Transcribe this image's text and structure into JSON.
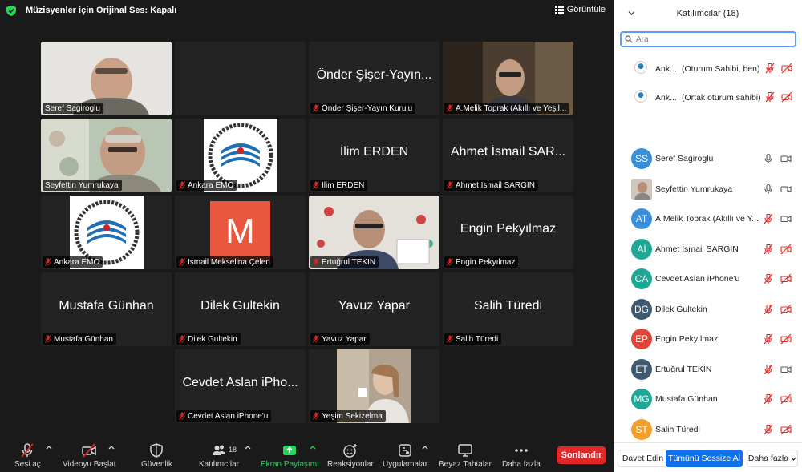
{
  "topbar": {
    "audio_status": "Müzisyenler için Orijinal Ses: Kapalı",
    "view_label": "Görüntüle"
  },
  "tiles": [
    {
      "big": "",
      "tag": "Seref Sagiroglu",
      "muted": false,
      "kind": "video"
    },
    {
      "big": "",
      "tag": "",
      "muted": false,
      "kind": "blank"
    },
    {
      "big": "Önder Şişer-Yayın...",
      "tag": "Önder Şişer-Yayın Kurulu",
      "muted": true,
      "kind": "name"
    },
    {
      "big": "",
      "tag": "A.Melik Toprak (Akıllı ve Yeşil...",
      "muted": true,
      "kind": "video"
    },
    {
      "big": "",
      "tag": "Seyfettin Yumrukaya",
      "muted": false,
      "kind": "video"
    },
    {
      "big": "",
      "tag": "Ankara EMO",
      "muted": true,
      "kind": "logo"
    },
    {
      "big": "İlim ERDEN",
      "tag": "İlim ERDEN",
      "muted": true,
      "kind": "name"
    },
    {
      "big": "Ahmet İsmail SAR...",
      "tag": "Ahmet İsmail SARGIN",
      "muted": true,
      "kind": "name"
    },
    {
      "big": "",
      "tag": "Ankara EMO",
      "muted": true,
      "kind": "logo"
    },
    {
      "big": "M",
      "tag": "İsmail Mekselina Çelen",
      "muted": true,
      "kind": "letter"
    },
    {
      "big": "",
      "tag": "Ertuğrul TEKİN",
      "muted": true,
      "kind": "video"
    },
    {
      "big": "Engin Pekyılmaz",
      "tag": "Engin Pekyılmaz",
      "muted": true,
      "kind": "name"
    },
    {
      "big": "Mustafa Günhan",
      "tag": "Mustafa Günhan",
      "muted": true,
      "kind": "name"
    },
    {
      "big": "Dilek Gultekin",
      "tag": "Dilek Gultekin",
      "muted": true,
      "kind": "name"
    },
    {
      "big": "Yavuz Yapar",
      "tag": "Yavuz Yapar",
      "muted": true,
      "kind": "name"
    },
    {
      "big": "Salih Türedi",
      "tag": "Salih Türedi",
      "muted": true,
      "kind": "name"
    },
    {
      "big": "Cevdet Aslan iPho...",
      "tag": "Cevdet Aslan iPhone'u",
      "muted": true,
      "kind": "name"
    },
    {
      "big": "",
      "tag": "Yeşim Sekizelma",
      "muted": true,
      "kind": "video"
    }
  ],
  "toolbar": {
    "unmute": "Sesi aç",
    "start_video": "Videoyu Başlat",
    "security": "Güvenlik",
    "participants": "Katılımcılar",
    "participants_count": "18",
    "share": "Ekran Paylaşımı",
    "reactions": "Reaksiyonlar",
    "apps": "Uygulamalar",
    "whiteboards": "Beyaz Tahtalar",
    "more": "Daha fazla",
    "end": "Sonlandır"
  },
  "sidebar": {
    "title": "Katılımcılar (18)",
    "search_placeholder": "Ara",
    "hosts": [
      {
        "name": "Ank...",
        "role": "(Oturum Sahibi, ben)"
      },
      {
        "name": "Ank...",
        "role": "(Ortak oturum sahibi)"
      }
    ],
    "participants": [
      {
        "initials": "SS",
        "name": "Seref Sagiroglu",
        "color": "#3a8fd9",
        "muted": false,
        "video": true,
        "photo": false
      },
      {
        "initials": "",
        "name": "Seyfettin Yumrukaya",
        "color": "#8a7a6a",
        "muted": false,
        "video": true,
        "photo": true
      },
      {
        "initials": "AT",
        "name": "A.Melik Toprak (Akıllı ve Y...",
        "color": "#3a8fd9",
        "muted": true,
        "video": true,
        "photo": false
      },
      {
        "initials": "Aİ",
        "name": "Ahmet İsmail SARGIN",
        "color": "#1fa795",
        "muted": true,
        "video": false,
        "photo": false
      },
      {
        "initials": "CA",
        "name": "Cevdet Aslan iPhone'u",
        "color": "#1fa795",
        "muted": true,
        "video": false,
        "photo": false
      },
      {
        "initials": "DG",
        "name": "Dilek Gultekin",
        "color": "#3f5a70",
        "muted": true,
        "video": false,
        "photo": false
      },
      {
        "initials": "EP",
        "name": "Engin Pekyılmaz",
        "color": "#e0453a",
        "muted": true,
        "video": false,
        "photo": false
      },
      {
        "initials": "ET",
        "name": "Ertuğrul TEKİN",
        "color": "#3f5a70",
        "muted": true,
        "video": true,
        "photo": false
      },
      {
        "initials": "MG",
        "name": "Mustafa Günhan",
        "color": "#1fa795",
        "muted": true,
        "video": false,
        "photo": false
      },
      {
        "initials": "ST",
        "name": "Salih Türedi",
        "color": "#f0a02a",
        "muted": true,
        "video": false,
        "photo": false
      }
    ],
    "invite": "Davet Edin",
    "mute_all": "Tümünü Sessize Al",
    "more": "Daha fazla"
  }
}
